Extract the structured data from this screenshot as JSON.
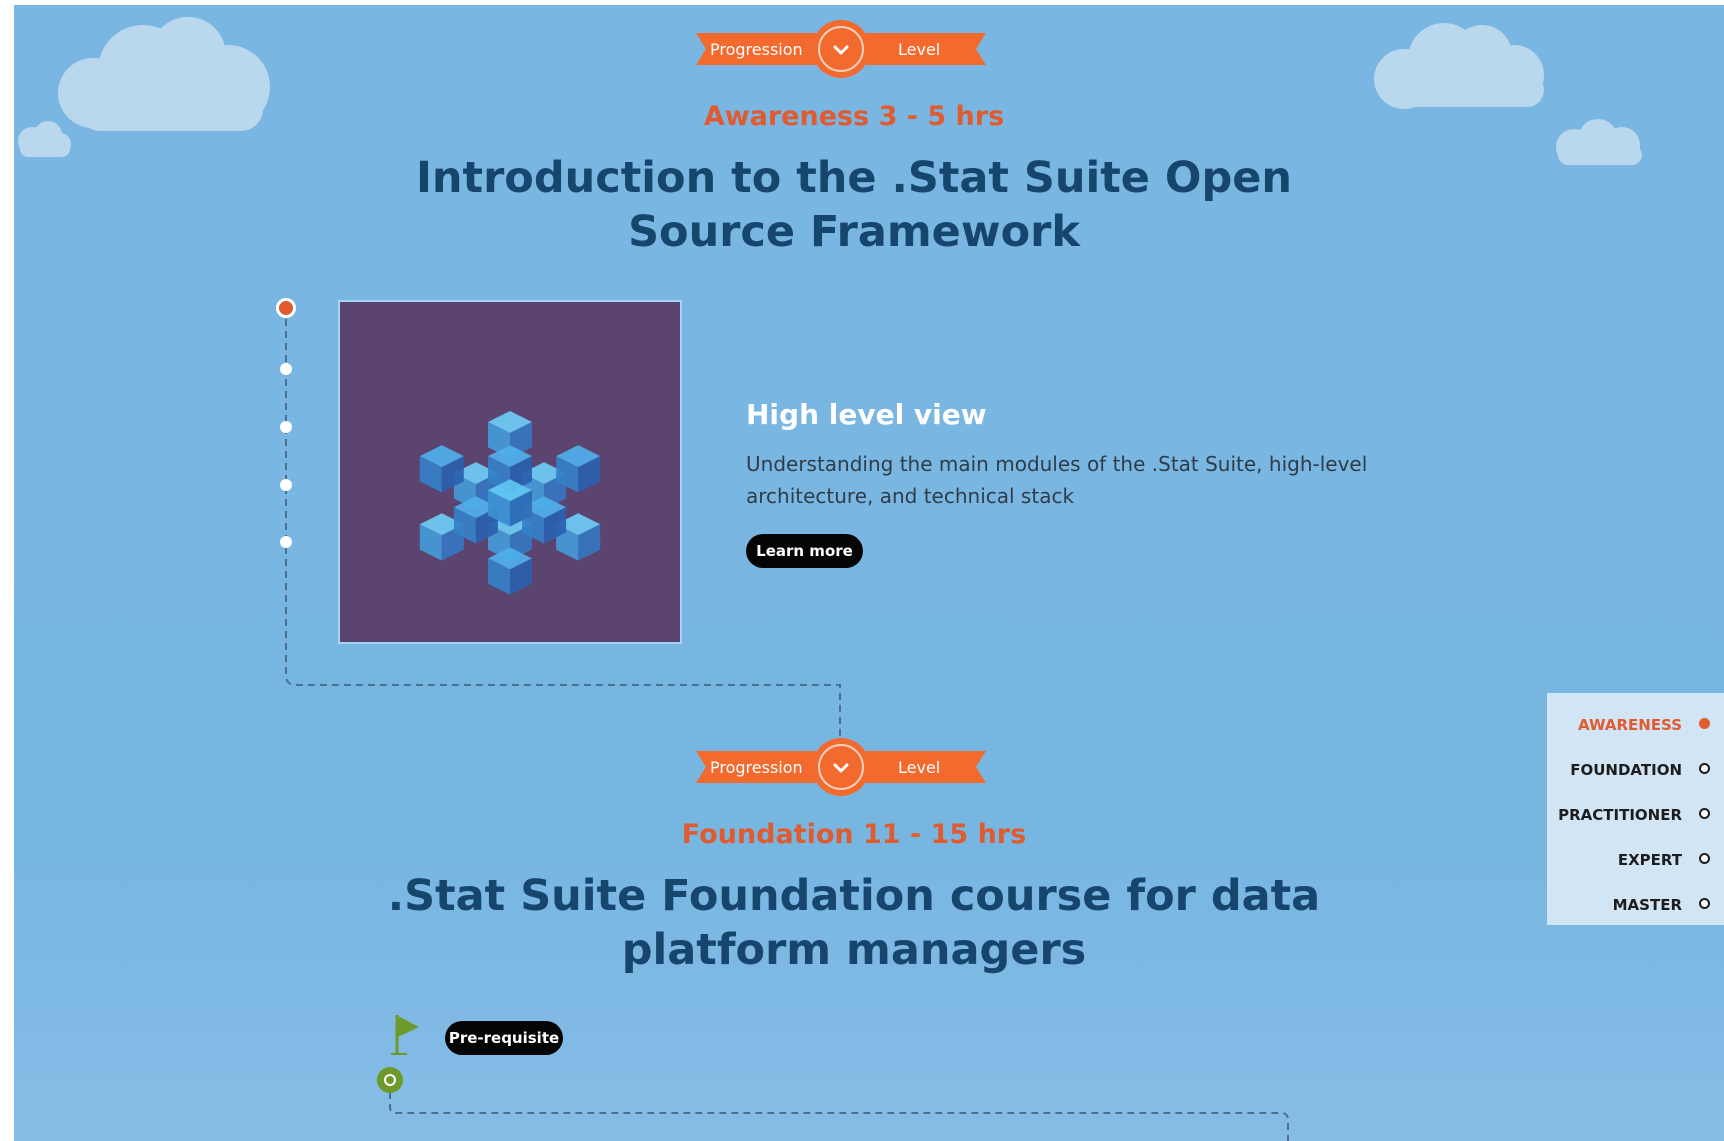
{
  "ribbon": {
    "left_label": "Progression",
    "right_label": "Level",
    "toggle_icon": "chevron-down-icon"
  },
  "awareness": {
    "time": "Awareness 3 - 5 hrs",
    "title_line1": "Introduction to the .Stat Suite Open",
    "title_line2": "Source Framework",
    "module": {
      "title": "High level view",
      "description": "Understanding the main modules of the .Stat Suite, high-level architecture, and technical stack",
      "button_label": "Learn more",
      "image_icon": "cube-grid-icon"
    }
  },
  "foundation": {
    "time": "Foundation 11 - 15 hrs",
    "title_line1": ".Stat Suite Foundation course for data",
    "title_line2": "platform managers",
    "prerequisite_label": "Pre-requisite",
    "flag_icon": "flag-icon"
  },
  "level_nav": {
    "items": [
      {
        "label": "AWARENESS",
        "active": true
      },
      {
        "label": "FOUNDATION",
        "active": false
      },
      {
        "label": "PRACTITIONER",
        "active": false
      },
      {
        "label": "EXPERT",
        "active": false
      },
      {
        "label": "MASTER",
        "active": false
      }
    ]
  },
  "colors": {
    "sky": "#7ab6e2",
    "accent_orange": "#f26a2e",
    "level_text": "#e05b2f",
    "title_navy": "#16456e",
    "prereq_green": "#6e9a2c",
    "nav_panel": "#d2e5f5"
  }
}
